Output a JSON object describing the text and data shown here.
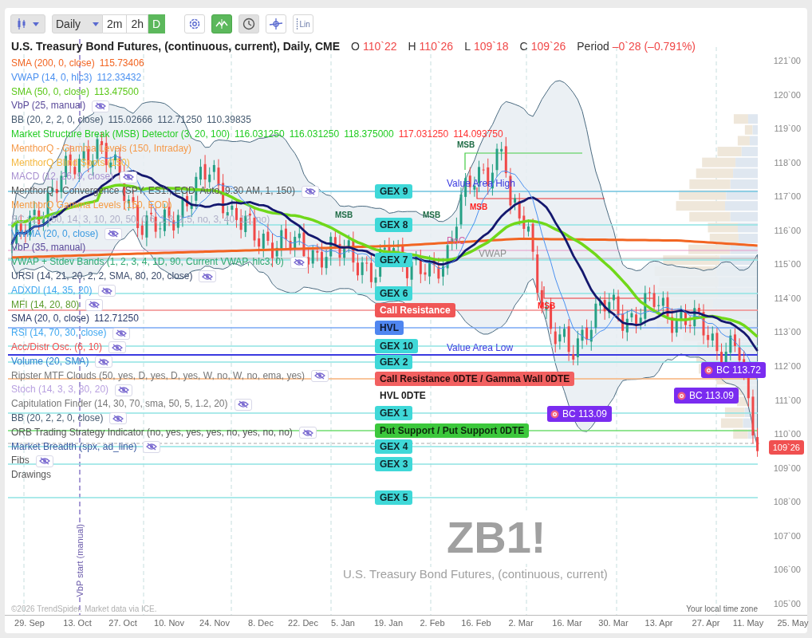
{
  "toolbar": {
    "interval": {
      "value": "Daily"
    },
    "quick_intervals": [
      {
        "label": "2m",
        "selected": false
      },
      {
        "label": "2h",
        "selected": false
      },
      {
        "label": "D",
        "selected": true
      }
    ],
    "tools": [
      {
        "kind": "settings",
        "on": false
      },
      {
        "kind": "line-chart",
        "on": true
      },
      {
        "kind": "clock",
        "on": true
      },
      {
        "kind": "crosshair",
        "on": false
      },
      {
        "kind": "scale",
        "label": "Lin",
        "on": false
      }
    ]
  },
  "title": "U.S. Treasury Bond Futures, (continuous, current), Daily, CME",
  "ohlc": [
    {
      "label": "O",
      "value": "110`22"
    },
    {
      "label": "H",
      "value": "110`26"
    },
    {
      "label": "L",
      "value": "109`18"
    },
    {
      "label": "C",
      "value": "109`26"
    }
  ],
  "period": {
    "label": "Period",
    "value": "–0`28 (–0.791%)"
  },
  "indicators": [
    {
      "name": "SMA (200, 0, close)",
      "color": "#f26522",
      "values": [
        {
          "text": "115.73406",
          "color": "#f26522"
        }
      ],
      "toggle": false
    },
    {
      "name": "VWAP (14, 0, hlc3)",
      "color": "#4a90f0",
      "values": [
        {
          "text": "112.33432",
          "color": "#4a90f0"
        }
      ],
      "toggle": false
    },
    {
      "name": "SMA (50, 0, close)",
      "color": "#5cc81a",
      "values": [
        {
          "text": "113.47500",
          "color": "#5cc81a"
        }
      ],
      "toggle": false
    },
    {
      "name": "VbP (25, manual)",
      "color": "#5a4a9a",
      "toggle": true
    },
    {
      "name": "BB (20, 2, 2, 0, close)",
      "color": "#455a70",
      "values": [
        {
          "text": "115.02666",
          "color": "#455a70"
        },
        {
          "text": "112.71250",
          "color": "#455a70"
        },
        {
          "text": "110.39835",
          "color": "#455a70"
        }
      ],
      "toggle": false
    },
    {
      "name": "Market Structure Break (MSB) Detector (3, 20, 100)",
      "color": "#22cc22",
      "values": [
        {
          "text": "116.031250",
          "color": "#22cc22"
        },
        {
          "text": "116.031250",
          "color": "#22cc22"
        },
        {
          "text": "118.375000",
          "color": "#22cc22"
        },
        {
          "text": "117.031250",
          "color": "#ff3333"
        },
        {
          "text": "114.093750",
          "color": "#ff3333"
        }
      ],
      "toggle": false
    },
    {
      "name": "MenthorQ - Gamma Levels (150, Intraday)",
      "color": "#f59a4a",
      "toggle": false
    },
    {
      "name": "MenthorQ Blind Spots (150)",
      "color": "#f5b840",
      "toggle": false
    },
    {
      "name": "MACD (12, 26, 9, close)",
      "color": "#a890d0",
      "toggle": true
    },
    {
      "name": "MenthorQ - Convergence (SPY, ES1!, EOD, Auto, 9:30 AM, 1, 150)",
      "color": "#555555",
      "toggle": true
    },
    {
      "name": "MenthorQ Gamma Levels (150, EOD)",
      "color": "#f59a40",
      "toggle": false
    },
    {
      "name": "BC v2.7 (50, 14, 3, 10, 20, 50, 0.6, 1.3, 1.5, no, 3, 40, 12, no)",
      "color": "#b0b0c8",
      "toggle": false
    },
    {
      "name": "VWMA (20, 0, close)",
      "color": "#3a9ae0",
      "toggle": true
    },
    {
      "name": "VbP (35, manual)",
      "color": "#5a4a9a",
      "toggle": false
    },
    {
      "name": "VWAP + Stdev Bands (1, 2, 3, 4, 1D, 90, Current VWAP, hlc3, 0)",
      "color": "#30a870",
      "toggle": true
    },
    {
      "name": "URSI (14, 21, 20, 2, 2, SMA, 80, 20, close)",
      "color": "#3a4a6a",
      "toggle": true
    },
    {
      "name": "ADXDI (14, 35, 20)",
      "color": "#40a8f0",
      "toggle": true
    },
    {
      "name": "MFI (14, 20, 80)",
      "color": "#5a9a2a",
      "toggle": true
    },
    {
      "name": "SMA (20, 0, close)",
      "color": "#2a3a6a",
      "values": [
        {
          "text": "112.71250",
          "color": "#2a3a6a"
        }
      ],
      "toggle": false
    },
    {
      "name": "RSI (14, 70, 30, close)",
      "color": "#40a8f0",
      "toggle": true
    },
    {
      "name": "Acc/Distr Osc. (6, 10)",
      "color": "#f05050",
      "toggle": true
    },
    {
      "name": "Volume (20, SMA)",
      "color": "#2a80d0",
      "toggle": true
    },
    {
      "name": "Ripster MTF Clouds (50, yes, D, yes, D, yes, W, no, W, no, ema, yes)",
      "color": "#777777",
      "toggle": true
    },
    {
      "name": "Stoch (14, 3, 3, 80, 20)",
      "color": "#b8a0e0",
      "toggle": true
    },
    {
      "name": "Capitulation Finder (14, 30, 70, sma, 50, 5, 1.2, 20)",
      "color": "#777777",
      "toggle": true
    },
    {
      "name": "BB (20, 2, 2, 0, close)",
      "color": "#455a70",
      "toggle": true
    },
    {
      "name": "ORB Trading Strategy Indicator (no, yes, yes, yes, no, yes, no, no)",
      "color": "#555555",
      "toggle": true
    },
    {
      "name": "Market Breadth (spx, ad_line)",
      "color": "#3a5aa0",
      "toggle": true
    },
    {
      "name": "Fibs",
      "color": "#555555",
      "toggle": true
    },
    {
      "name": "Drawings",
      "color": "#555555",
      "toggle": false
    }
  ],
  "levels": [
    {
      "label": "GEX 9",
      "kind": "gex"
    },
    {
      "label": "GEX 8",
      "kind": "gex"
    },
    {
      "label": "GEX 7",
      "kind": "gex"
    },
    {
      "label": "GEX 6",
      "kind": "gex"
    },
    {
      "label": "Call Resistance",
      "kind": "call"
    },
    {
      "label": "HVL",
      "kind": "hvl"
    },
    {
      "label": "GEX 10",
      "kind": "gex"
    },
    {
      "label": "GEX 2",
      "kind": "gex"
    },
    {
      "label": "Call Resistance 0DTE / Gamma Wall 0DTE",
      "kind": "call_0dte"
    },
    {
      "label": "HVL 0DTE",
      "kind": "hvl_0dte"
    },
    {
      "label": "GEX 1",
      "kind": "gex"
    },
    {
      "label": "Put Support / Put Support 0DTE",
      "kind": "put"
    },
    {
      "label": "GEX 4",
      "kind": "gex"
    },
    {
      "label": "GEX 3",
      "kind": "gex"
    },
    {
      "label": "GEX 5",
      "kind": "gex"
    }
  ],
  "value_area": [
    {
      "label": "Value Area High"
    },
    {
      "label": "PoC"
    },
    {
      "label": "VWAP"
    },
    {
      "label": "Value Area Low"
    }
  ],
  "msb_markers": [
    {
      "label": "MSB",
      "color": "#1e6b45"
    },
    {
      "label": "MSB",
      "color": "#1e6b45"
    },
    {
      "label": "MSB",
      "color": "#1e6b45"
    },
    {
      "label": "MSB",
      "color": "#ff2020"
    },
    {
      "label": "MSB",
      "color": "#ff2020"
    }
  ],
  "bc_markers": [
    {
      "label": "BC 113.09"
    },
    {
      "label": "BC 113.09"
    },
    {
      "label": "BC 113.72"
    }
  ],
  "watermark": {
    "symbol": "ZB1!",
    "name": "U.S. Treasury Bond Futures, (continuous, current)"
  },
  "price_axis": [
    "121`00",
    "120`00",
    "119`00",
    "118`00",
    "117`00",
    "116`00",
    "115`00",
    "114`00",
    "113`00",
    "112`00",
    "111`00",
    "110`00",
    "109`00",
    "108`00",
    "107`00",
    "106`00",
    "105`00"
  ],
  "current_price": "109`26",
  "vbp_marker": "VbP start (manual)",
  "time_axis": [
    "29. Sep",
    "13. Oct",
    "27. Oct",
    "10. Nov",
    "24. Nov",
    "8. Dec",
    "22. Dec",
    "5. Jan",
    "19. Jan",
    "2. Feb",
    "16. Feb",
    "2. Mar",
    "16. Mar",
    "30. Mar",
    "13. Apr",
    "27. Apr",
    "11. May",
    "25. May"
  ],
  "footer": {
    "credit": "©2026 TrendSpider. Market data via ICE.",
    "timezone": "Your local time zone"
  }
}
